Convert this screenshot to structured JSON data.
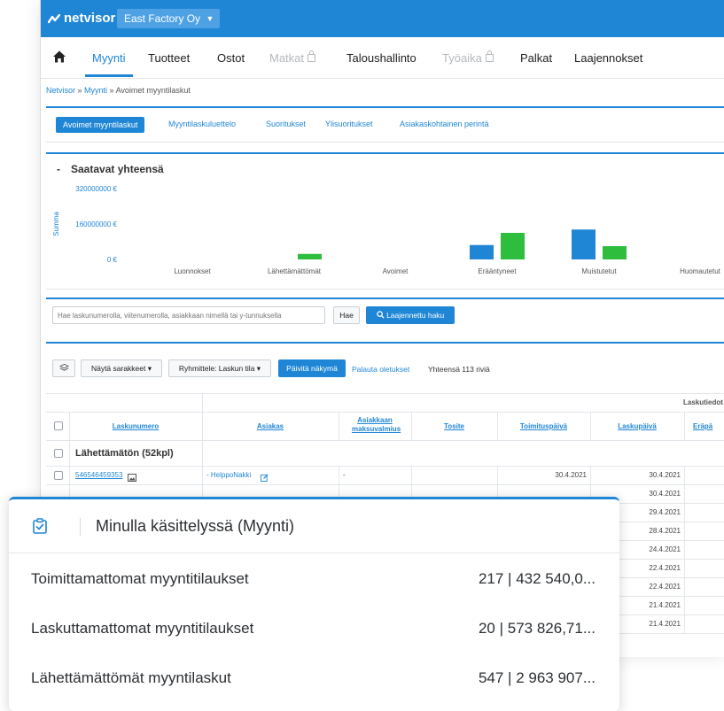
{
  "brand": {
    "name": "netvisor",
    "company": "East Factory Oy"
  },
  "nav": [
    {
      "label": "Myynti",
      "state": "active"
    },
    {
      "label": "Tuotteet",
      "state": "normal"
    },
    {
      "label": "Ostot",
      "state": "normal"
    },
    {
      "label": "Matkat",
      "state": "disabled"
    },
    {
      "label": "Taloushallinto",
      "state": "normal"
    },
    {
      "label": "Työaika",
      "state": "disabled"
    },
    {
      "label": "Palkat",
      "state": "normal"
    },
    {
      "label": "Laajennokset",
      "state": "normal"
    }
  ],
  "breadcrumb": {
    "root": "Netvisor",
    "section": "Myynti",
    "sep": " » ",
    "current": "Avoimet myyntilaskut"
  },
  "subtabs": [
    "Avoimet myyntilaskut",
    "Myyntilaskuluettelo",
    "Suoritukset",
    "Ylisuoritukset",
    "Asiakaskohtainen perintä"
  ],
  "chart_section": {
    "title": "Saatavat yhteensä",
    "collapse": "-"
  },
  "chart_data": {
    "type": "bar",
    "ylabel": "Summa",
    "ylim": [
      0,
      320000000
    ],
    "y_ticks": [
      "320000000 €",
      "160000000 €",
      "0 €"
    ],
    "categories": [
      "Luonnokset",
      "Lähettämättömät",
      "Avoimet",
      "Erääntyneet",
      "Muistutetut",
      "Huomautetut"
    ],
    "series": [
      {
        "color": "#1f86d6",
        "values": [
          0,
          0,
          0,
          65000000,
          135000000,
          0
        ]
      },
      {
        "color": "#2ebd3c",
        "values": [
          0,
          25000000,
          0,
          120000000,
          60000000,
          0
        ]
      }
    ]
  },
  "search": {
    "placeholder": "Hae laskunumerolla, viitenumerolla, asiakkaan nimellä tai y-tunnuksella",
    "button": "Hae",
    "advanced": "Laajennettu haku"
  },
  "toolbar": {
    "columns": "Näytä sarakkeet",
    "group": "Ryhmittele: Laskun tila",
    "refresh": "Päivitä näkymä",
    "reset": "Palauta oletukset",
    "total": "Yhteensä 113 riviä"
  },
  "table": {
    "group_header": "Laskutiedot",
    "headers": [
      "Laskunumero",
      "Asiakas",
      "Asiakkaan maksuvalmius",
      "Tosite",
      "Toimituspäivä",
      "Laskupäivä",
      "Eräpä"
    ],
    "group_row": "Lähettämätön (52kpl)",
    "first_row": {
      "number": "546546459353",
      "customer": "- HelppoNakki",
      "readiness": "-",
      "delivery": "30.4.2021",
      "invoice": "30.4.2021"
    },
    "other_dates": [
      "30.4.2021",
      "29.4.2021",
      "28.4.2021",
      "24.4.2021",
      "22.4.2021",
      "22.4.2021",
      "21.4.2021",
      "21.4.2021"
    ]
  },
  "overlay": {
    "title": "Minulla käsittelyssä (Myynti)",
    "rows": [
      {
        "label": "Toimittamattomat myyntitilaukset",
        "value": "217 | 432 540,0..."
      },
      {
        "label": "Laskuttamattomat myyntitilaukset",
        "value": "20 | 573 826,71..."
      },
      {
        "label": "Lähettämättömät myyntilaskut",
        "value": "547 | 2 963 907..."
      }
    ]
  }
}
